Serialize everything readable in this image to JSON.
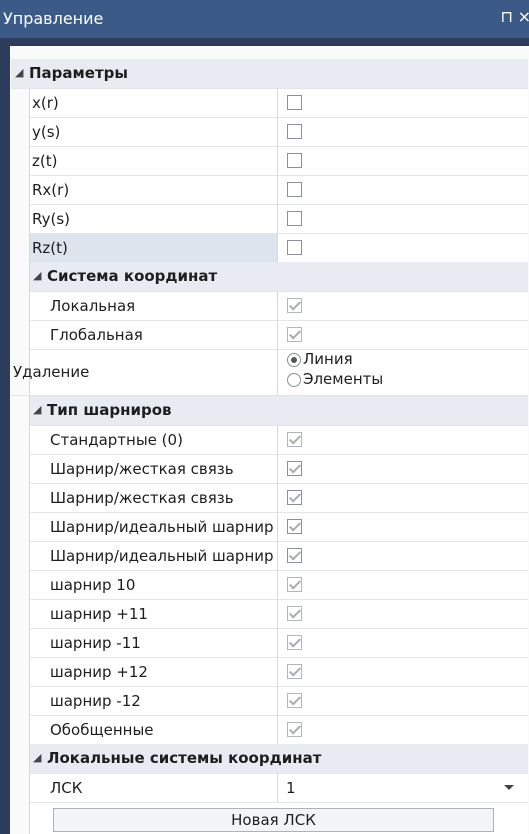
{
  "window": {
    "title": "Управление",
    "pin_icon": "pin-icon",
    "close_icon": "close-icon"
  },
  "categories": {
    "params": "Параметры",
    "coords": "Система координат",
    "hinges": "Тип шарниров",
    "lsk": "Локальные системы координат"
  },
  "params": [
    {
      "label": "x(r)",
      "checked": false
    },
    {
      "label": "y(s)",
      "checked": false
    },
    {
      "label": "z(t)",
      "checked": false
    },
    {
      "label": "Rx(r)",
      "checked": false
    },
    {
      "label": "Ry(s)",
      "checked": false
    },
    {
      "label": "Rz(t)",
      "checked": false
    }
  ],
  "coords": [
    {
      "label": "Локальная",
      "checked": true
    },
    {
      "label": "Глобальная",
      "checked": true
    }
  ],
  "deletion": {
    "label": "Удаление",
    "options": [
      "Линия",
      "Элементы"
    ],
    "selected": "Линия"
  },
  "hinges": [
    {
      "label": "Стандартные (0)",
      "checked": true
    },
    {
      "label": "Шарнир/жесткая связь",
      "checked": true
    },
    {
      "label": "Шарнир/жесткая связь",
      "checked": true
    },
    {
      "label": "Шарнир/идеальный шарнир",
      "checked": true
    },
    {
      "label": "Шарнир/идеальный шарнир",
      "checked": true
    },
    {
      "label": "шарнир 10",
      "checked": true
    },
    {
      "label": "шарнир +11",
      "checked": true
    },
    {
      "label": "шарнир -11",
      "checked": true
    },
    {
      "label": "шарнир +12",
      "checked": true
    },
    {
      "label": "шарнир -12",
      "checked": true
    },
    {
      "label": "Обобщенные",
      "checked": true
    }
  ],
  "lsk": {
    "label": "ЛСК",
    "value": "1",
    "new_button": "Новая ЛСК"
  }
}
